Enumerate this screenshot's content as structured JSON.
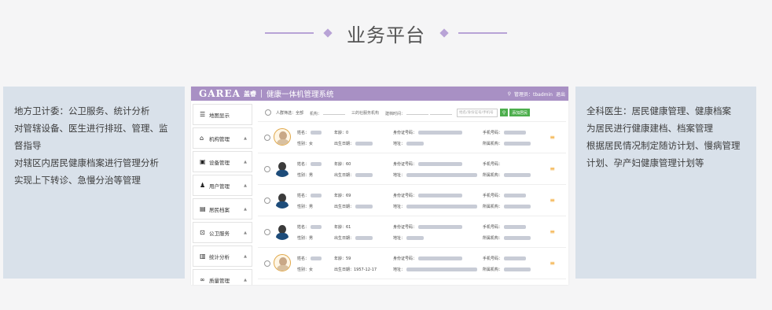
{
  "title": "业务平台",
  "left_panel": {
    "lines": [
      "地方卫计委：公卫服务、统计分析",
      "对管辖设备、医生进行排班、管理、监督指导",
      "对辖区内居民健康档案进行管理分析",
      "实现上下转诊、急慢分治等管理"
    ]
  },
  "right_panel": {
    "lines": [
      "全科医生：居民健康管理、健康档案",
      "为居民进行健康建档、档案管理",
      "根据居民情况制定随访计划、慢病管理",
      "计划、孕产妇健康管理计划等"
    ]
  },
  "app": {
    "logo": "GAREA",
    "logo_sub": "盖睿",
    "system_name": "健康一体机管理系统",
    "user_label": "管理员：tbadmin",
    "logout_label": "退出",
    "sidebar": [
      {
        "icon": "list-icon",
        "glyph": "☰",
        "label": "地图显示"
      },
      {
        "icon": "building-icon",
        "glyph": "⌂",
        "label": "机构管理"
      },
      {
        "icon": "device-icon",
        "glyph": "▣",
        "label": "设备管理"
      },
      {
        "icon": "user-icon",
        "glyph": "♟",
        "label": "用户管理"
      },
      {
        "icon": "archive-icon",
        "glyph": "▤",
        "label": "居民档案"
      },
      {
        "icon": "public-health-icon",
        "glyph": "⊡",
        "label": "公卫服务"
      },
      {
        "icon": "stats-icon",
        "glyph": "▥",
        "label": "统计分析"
      },
      {
        "icon": "quality-icon",
        "glyph": "∞",
        "label": "质量管理"
      },
      {
        "icon": "gear-icon",
        "glyph": "✿",
        "label": "系统维护"
      }
    ],
    "toolbar": {
      "filter1": "人群筛选：全部",
      "filter2": "机构：",
      "filter3": "三的社服务机构",
      "filter4": "建档时间：",
      "search_placeholder": "姓名/身份证号/手机号",
      "search_icon": "search-icon",
      "add_label": "添加居民"
    },
    "rows": [
      {
        "gender": "female",
        "name_label": "姓名：",
        "age": "年龄：0",
        "sex": "性别：女",
        "birth_label": "出生日期：",
        "id_label": "身份证号码：",
        "addr_label": "地址：",
        "phone_label": "手机号码：",
        "org_label": "所属机构："
      },
      {
        "gender": "male",
        "name_label": "姓名：",
        "age": "年龄：60",
        "sex": "性别：男",
        "birth_label": "出生日期：",
        "id_label": "身份证号码：",
        "addr_label": "地址：",
        "phone_label": "手机号码：",
        "org_label": "所属机构："
      },
      {
        "gender": "male",
        "name_label": "姓名：",
        "age": "年龄：69",
        "sex": "性别：男",
        "birth_label": "出生日期：",
        "id_label": "身份证号码：",
        "addr_label": "地址：",
        "phone_label": "手机号码：",
        "org_label": "所属机构："
      },
      {
        "gender": "male",
        "name_label": "姓名：",
        "age": "年龄：61",
        "sex": "性别：男",
        "birth_label": "出生日期：",
        "id_label": "身份证号码：",
        "addr_label": "地址：",
        "phone_label": "手机号码：",
        "org_label": "所属机构："
      },
      {
        "gender": "female",
        "name_label": "姓名：",
        "age": "年龄：59",
        "sex": "性别：女",
        "birth_label": "出生日期：1957-12-17",
        "id_label": "身份证号码：",
        "addr_label": "地址：",
        "phone_label": "手机号码：",
        "org_label": "所属机构："
      }
    ]
  }
}
